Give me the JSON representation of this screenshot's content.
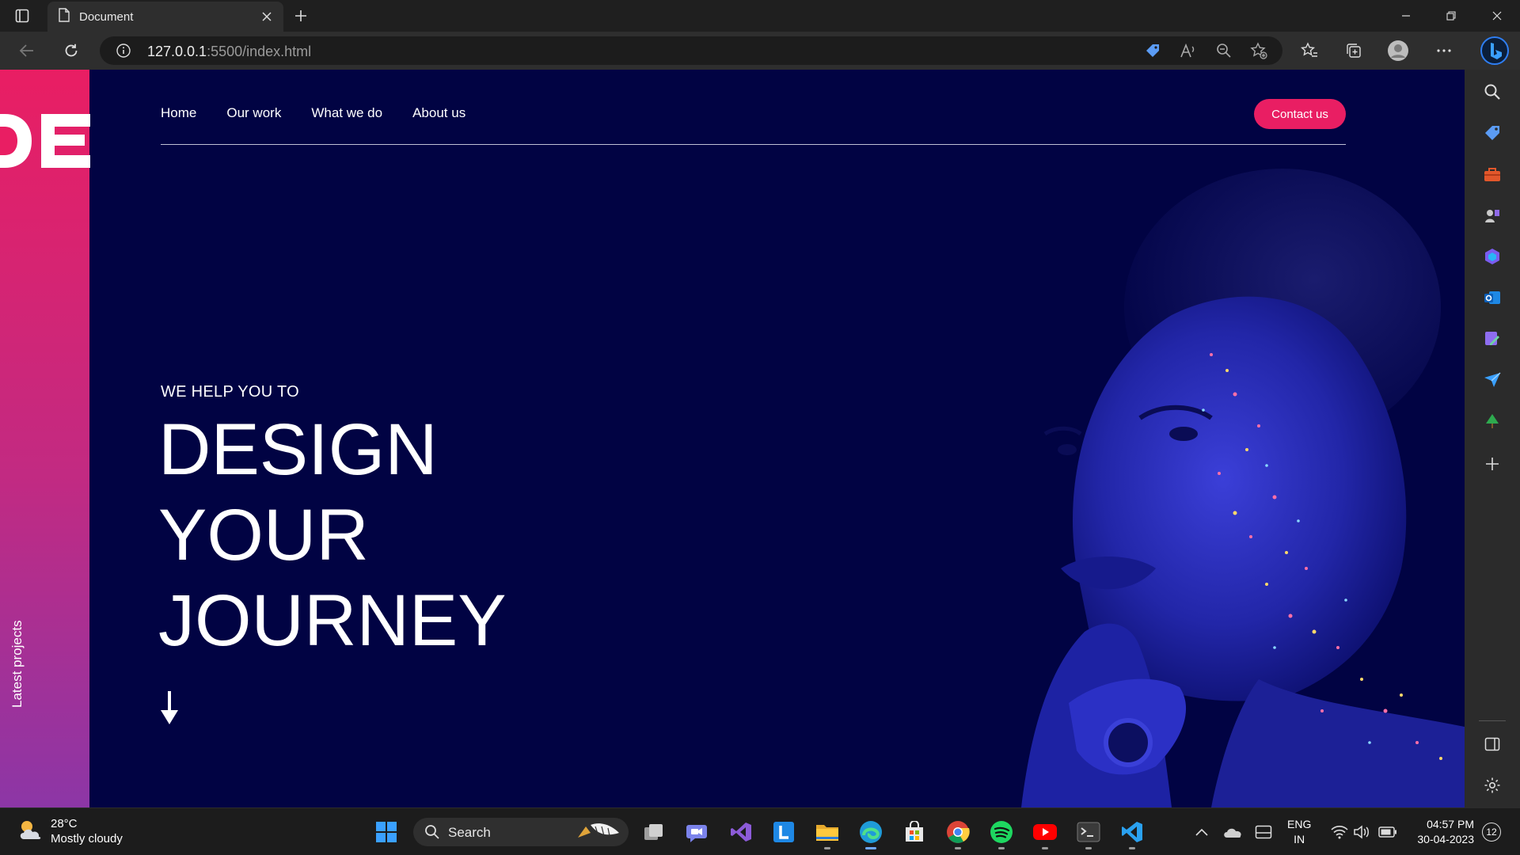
{
  "browser": {
    "tab_title": "Document",
    "url_host": "127.0.0.1",
    "url_rest": ":5500/index.html"
  },
  "site": {
    "nav": [
      "Home",
      "Our work",
      "What we do",
      "About us"
    ],
    "contact_label": "Contact us",
    "side_label": "Latest projects",
    "logo_text": "DE",
    "eyebrow": "WE HELP YOU TO",
    "headline": [
      "DESIGN",
      "YOUR",
      "JOURNEY"
    ],
    "colors": {
      "accent": "#e91e63",
      "background": "#010343"
    }
  },
  "taskbar": {
    "temperature": "28°C",
    "condition": "Mostly cloudy",
    "search_label": "Search",
    "lang": "ENG",
    "region": "IN",
    "time": "04:57 PM",
    "date": "30-04-2023",
    "notifications": "12"
  }
}
